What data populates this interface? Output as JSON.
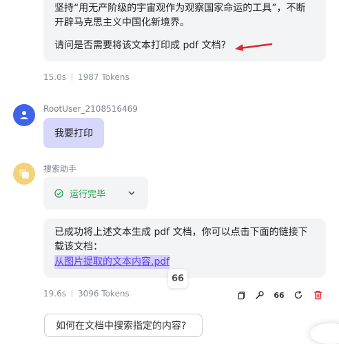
{
  "messages": {
    "first_reply": {
      "line1": "坚持“用无产阶级的宇宙观作为观察国家命运的工具”，不断",
      "line2": "开辟马克思主义中国化新境界。",
      "question": "请问是否需要将该文本打印成 pdf 文档?",
      "time": "15.0s",
      "tokens": "1987 Tokens"
    },
    "user": {
      "name": "RootUser_2108516469",
      "text": "我要打印"
    },
    "assistant": {
      "name": "搜索助手",
      "status": "运行完毕",
      "line1": "已成功将上述文本生成 pdf 文档，你可以点击下面的链接下",
      "line2": "载该文档：",
      "link": "从图片提取的文本内容.pdf",
      "time": "19.6s",
      "tokens": "3096 Tokens"
    }
  },
  "quote_glyph": "66",
  "toolbar": {
    "quote_label": "66"
  },
  "suggestion": "如何在文档中搜索指定的内容?",
  "colors": {
    "arrow": "#e0262f",
    "status_green": "#22a34a",
    "link": "#5b3ef2",
    "user_bubble": "#d7d6fb",
    "delete": "#e0262f"
  }
}
